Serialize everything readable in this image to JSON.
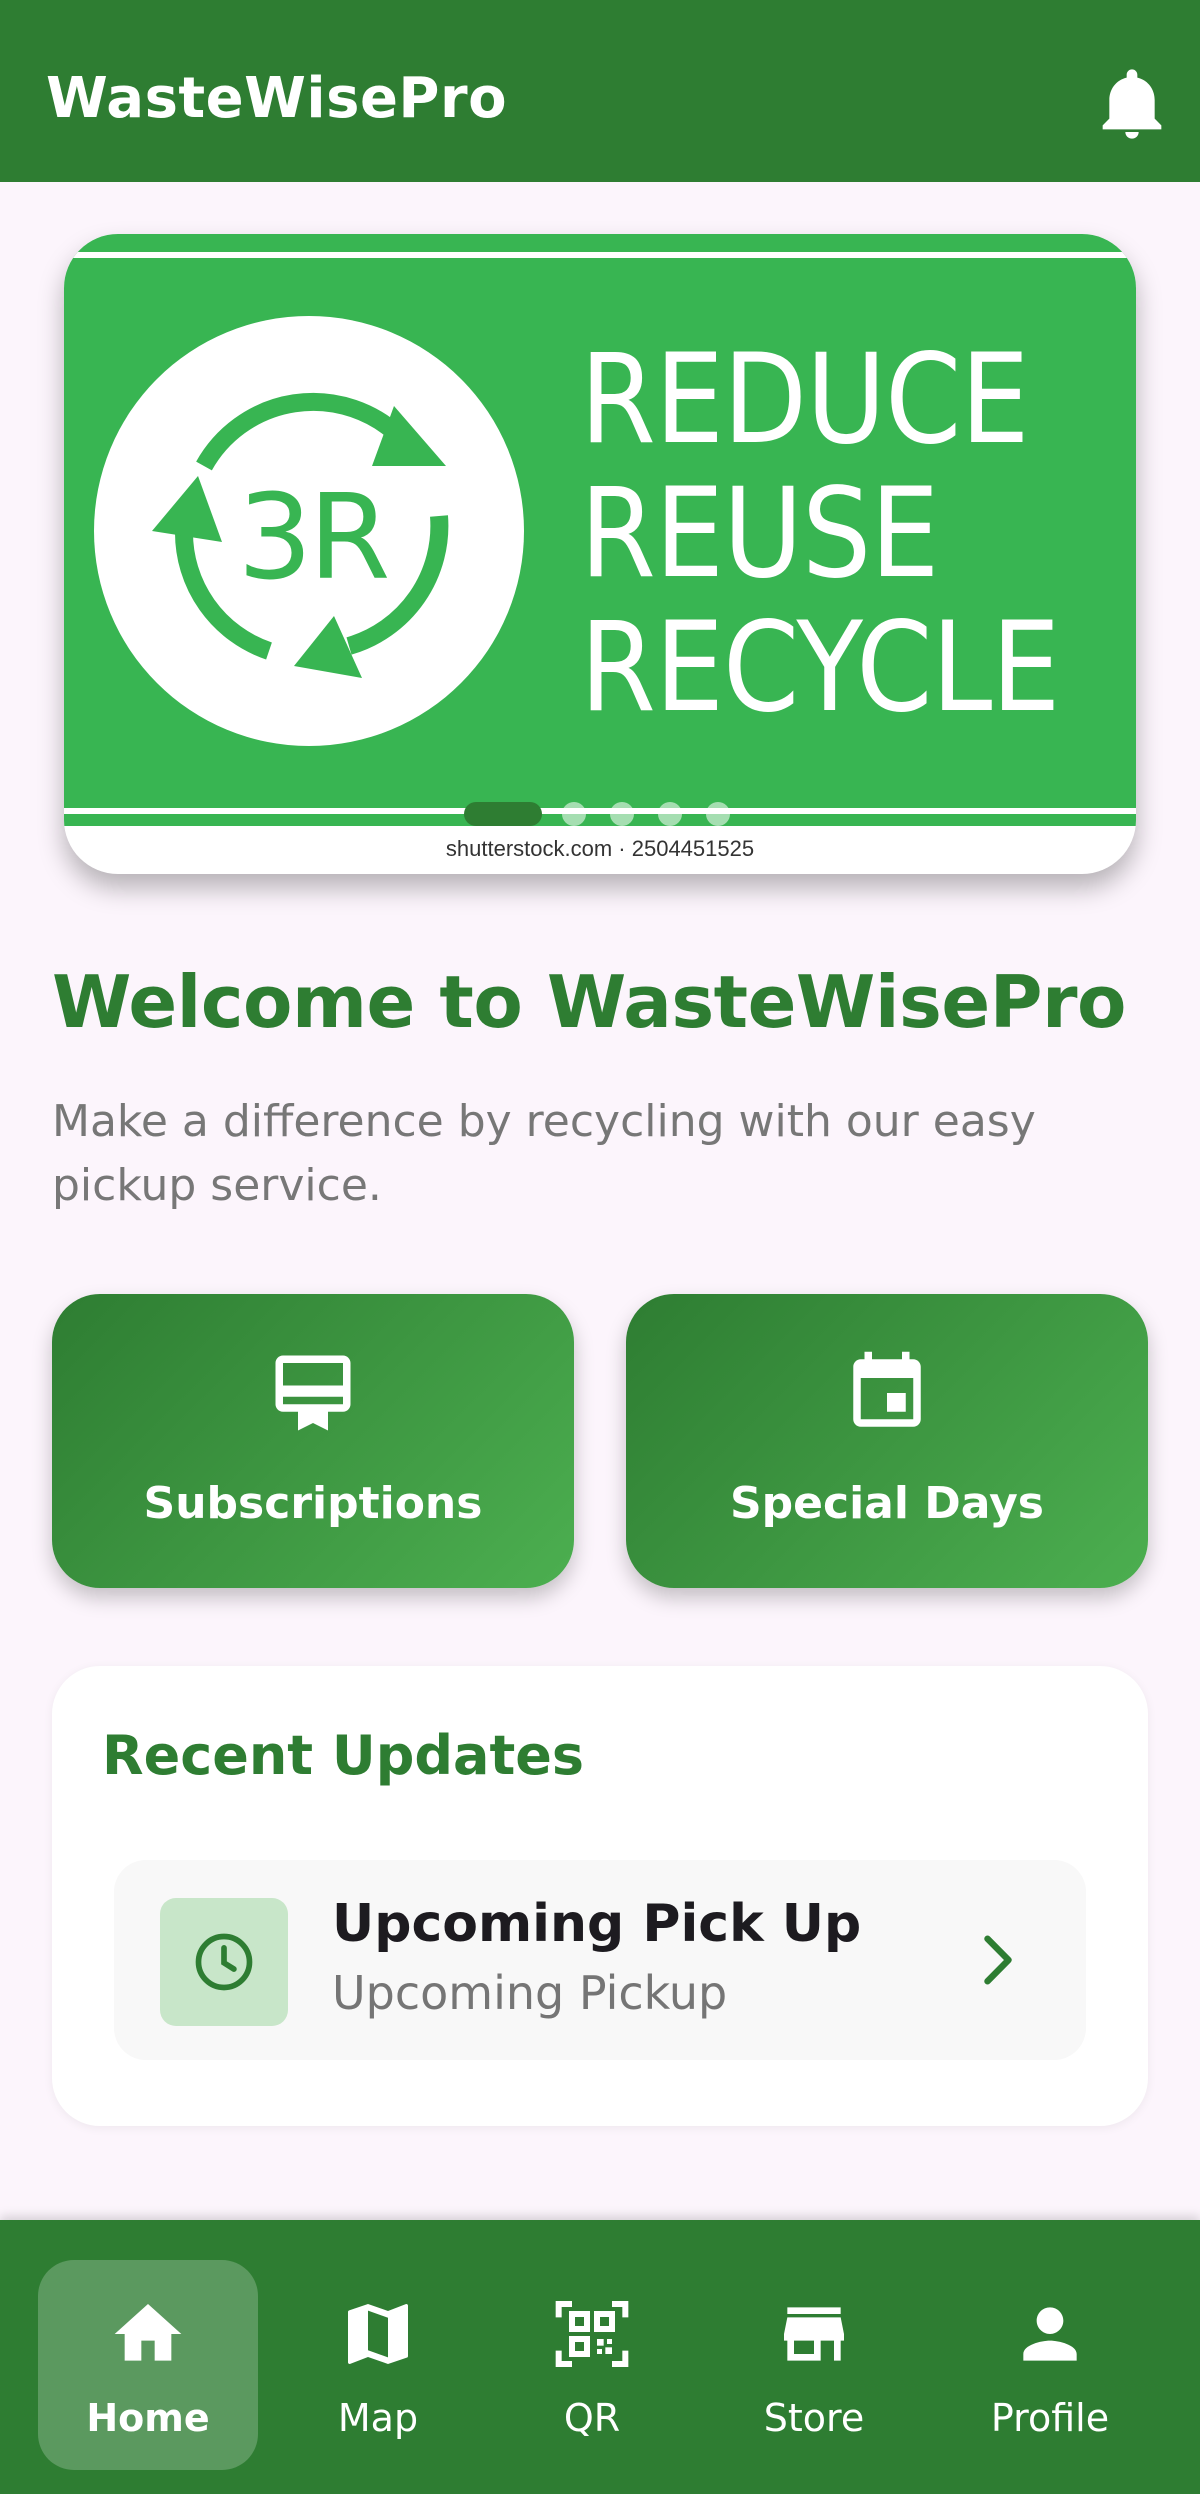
{
  "app": {
    "title": "WasteWisePro"
  },
  "banner": {
    "badge": "3R",
    "lines": [
      "REDUCE",
      "REUSE",
      "RECYCLE"
    ],
    "watermark": "shutterstock.com · 2504451525",
    "slide_count": 5,
    "active_slide": 1
  },
  "welcome": {
    "title": "Welcome to WasteWisePro",
    "subtitle": "Make a difference by recycling with our easy pickup service."
  },
  "tiles": [
    {
      "label": "Subscriptions",
      "icon": "card-membership-icon"
    },
    {
      "label": "Special Days",
      "icon": "event-calendar-icon"
    }
  ],
  "updates": {
    "title": "Recent Updates",
    "items": [
      {
        "title": "Upcoming Pick Up",
        "subtitle": "Upcoming Pickup",
        "icon": "clock-icon"
      }
    ]
  },
  "nav": {
    "items": [
      {
        "label": "Home",
        "icon": "home-icon",
        "active": true
      },
      {
        "label": "Map",
        "icon": "map-icon",
        "active": false
      },
      {
        "label": "QR",
        "icon": "qr-code-icon",
        "active": false
      },
      {
        "label": "Store",
        "icon": "store-icon",
        "active": false
      },
      {
        "label": "Profile",
        "icon": "person-icon",
        "active": false
      }
    ]
  },
  "colors": {
    "primary": "#2e7d32",
    "primary_light": "#4caf50",
    "banner_green": "#38b552",
    "background": "#fcf5fc",
    "icon_tint": "#c8e6c9"
  }
}
